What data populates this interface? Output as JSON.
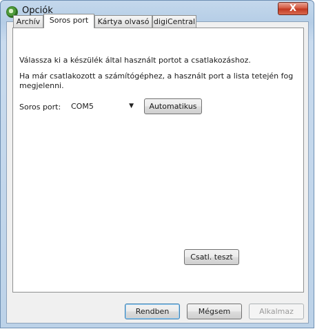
{
  "window": {
    "title": "Opciók",
    "close_label": "X"
  },
  "tabs": [
    {
      "label": "Archív"
    },
    {
      "label": "Soros port"
    },
    {
      "label": "Kártya olvasó"
    },
    {
      "label": "digiCentral"
    }
  ],
  "panel": {
    "instruction": "Válassza ki a készülék által használt portot a csatlakozáshoz.",
    "info_line1": "Ha már csatlakozott a számítógéphez, a használt port a lista tetején fog",
    "info_line2": "megjelenni.",
    "port_label": "Soros port:",
    "port_value": "COM5",
    "auto_button": "Automatikus",
    "test_button": "Csatl. teszt"
  },
  "footer": {
    "ok_button": "Rendben",
    "cancel_button": "Mégsem",
    "apply_button": "Alkalmaz"
  }
}
